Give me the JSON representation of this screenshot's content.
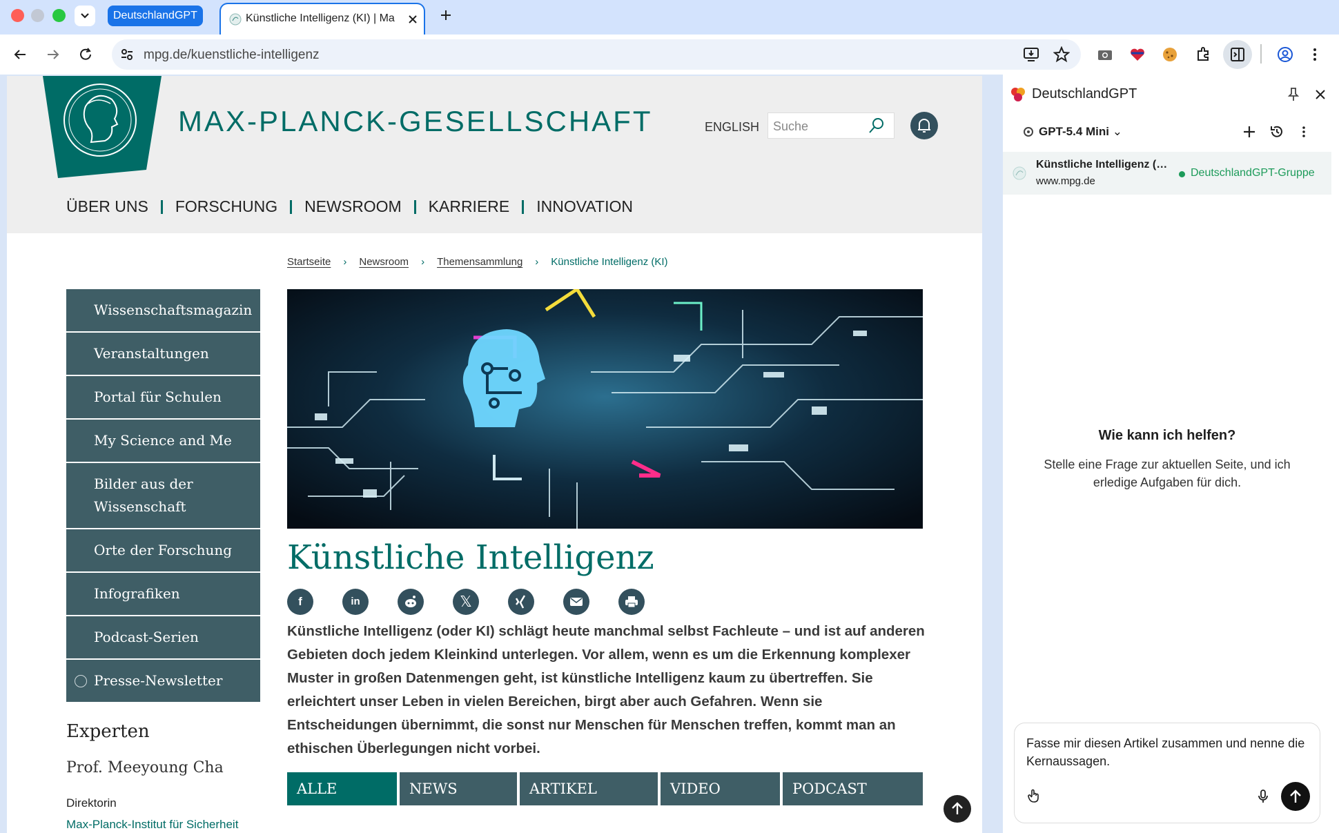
{
  "browser": {
    "tab_group_label": "DeutschlandGPT",
    "active_tab_title": "Künstliche Intelligenz (KI) | Max-Planck-Gesellschaft",
    "url_domain": "mpg.de",
    "url_path": "/kuenstliche-intelligenz"
  },
  "site": {
    "brand": "MAX-PLANCK-GESELLSCHAFT",
    "lang_link": "ENGLISH",
    "search_placeholder": "Suche",
    "nav": [
      "ÜBER UNS",
      "FORSCHUNG",
      "NEWSROOM",
      "KARRIERE",
      "INNOVATION"
    ],
    "breadcrumbs": [
      "Startseite",
      "Newsroom",
      "Themensammlung"
    ],
    "breadcrumb_current": "Künstliche Intelligenz (KI)",
    "sidebar": [
      "Wissenschaftsmagazin",
      "Veranstaltungen",
      "Portal für Schulen",
      "My Science and Me",
      "Bilder aus der Wissenschaft",
      "Orte der Forschung",
      "Infografiken",
      "Podcast-Serien",
      "Presse-Newsletter"
    ],
    "experts_heading": "Experten",
    "expert_name": "Prof. Meeyoung Cha",
    "expert_role": "Direktorin",
    "expert_institute": "Max-Planck-Institut für Sicherheit",
    "headline": "Künstliche Intelligenz",
    "intro": "Künstliche Intelligenz (oder KI) schlägt heute manchmal selbst Fachleute – und ist auf anderen Gebieten doch jedem Kleinkind unterlegen. Vor allem, wenn es um die Erkennung komplexer Muster in großen Datenmengen geht, ist künstliche Intelligenz kaum zu übertreffen. Sie erleichtert unser Leben in vielen Bereichen, birgt aber auch Gefahren. Wenn sie Entscheidungen übernimmt, die sonst nur Menschen für Menschen treffen, kommt man an ethischen Überlegungen nicht vorbei.",
    "filters": [
      "ALLE",
      "NEWS",
      "ARTIKEL",
      "VIDEO",
      "PODCAST"
    ],
    "share_icons": [
      "facebook-icon",
      "linkedin-icon",
      "reddit-icon",
      "x-icon",
      "xing-icon",
      "mail-icon",
      "print-icon"
    ],
    "accent_color": "#006c66",
    "sidebar_color": "#3f5e66"
  },
  "panel": {
    "title": "DeutschlandGPT",
    "model": "GPT-5.4 Mini",
    "context_title": "Künstliche Intelligenz (…",
    "context_site": "www.mpg.de",
    "context_group": "DeutschlandGPT-Gruppe",
    "help_title": "Wie kann ich helfen?",
    "help_sub": "Stelle eine Frage zur aktuellen Seite, und ich erledige Aufgaben für dich.",
    "input_text": "Fasse mir diesen Artikel zusammen und nenne die Kernaussagen."
  }
}
